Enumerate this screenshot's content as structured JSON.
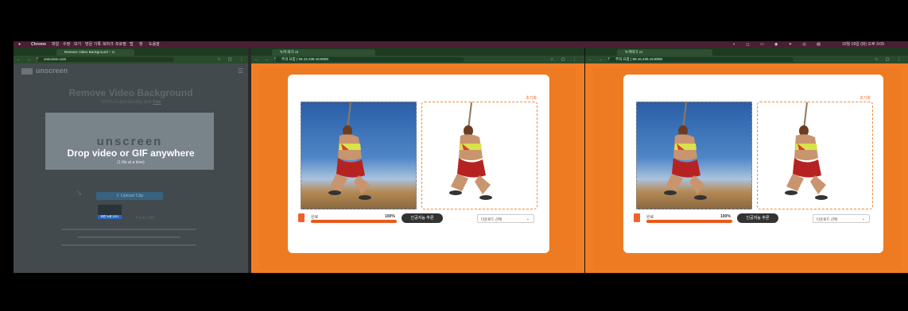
{
  "menubar": {
    "apple": "",
    "app": "Chrome",
    "items": [
      "파일",
      "수정",
      "보기",
      "방문 기록",
      "북마크",
      "프로필",
      "탭",
      "창",
      "도움말"
    ],
    "status": "10월 19일 (화) 오후 3:09"
  },
  "left_window": {
    "tab_title": "Remove Video Background – U",
    "url": "unscreen.com",
    "logo": "unscreen",
    "heading": "Remove Video Background",
    "subheading": "100% Automatically and",
    "subheading_link": "free",
    "drop_logo": "unscreen",
    "drop_title": "Drop video or GIF anywhere",
    "drop_sub": "(1 file at a time)",
    "upload_button": "Upload Clip",
    "thumb_label": "화면 녹화 2021",
    "paste_hint": "Paste URL"
  },
  "middle_window": {
    "tab_title": "누끼 따기 AI",
    "url": "주의 요함 | 59.15.239.16:8000",
    "reset": "초기화",
    "done_label": "완료",
    "progress_text": "100%",
    "progress_value": 1.0,
    "ai_button": "인공지능 추론",
    "select_value": "다운로드 선택"
  },
  "right_window": {
    "tab_title": "누끼따기 AI",
    "url": "주의 요함 | 59.15.239.16:8000",
    "reset": "초기화",
    "done_label": "완료",
    "progress_text": "100%",
    "progress_value": 1.0,
    "ai_button": "인공지능 추론",
    "select_value": "다운로드 선택"
  },
  "colors": {
    "accent_orange": "#f17e24",
    "progress_fill": "#e85a1c",
    "upload_blue": "#38627e"
  }
}
